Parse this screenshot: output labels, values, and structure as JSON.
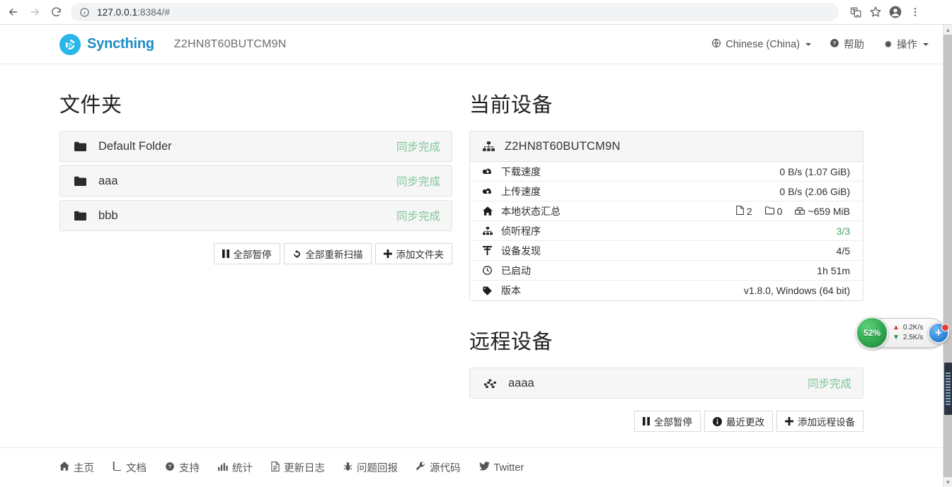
{
  "browser": {
    "url_main": "127.0.0.1",
    "url_rest": ":8384/#",
    "back_icon": "arrow-left-icon",
    "forward_icon": "arrow-right-icon",
    "reload_icon": "reload-icon",
    "info_icon": "info-circle-icon",
    "translate_icon": "translate-icon",
    "bookmark_icon": "star-icon",
    "profile_icon": "profile-avatar-icon",
    "menu_icon": "three-dot-menu-icon"
  },
  "navbar": {
    "brand": "Syncthing",
    "device_id": "Z2HN8T60BUTCM9N",
    "language": "Chinese (China)",
    "help": "帮助",
    "actions": "操作"
  },
  "folders": {
    "title": "文件夹",
    "items": [
      {
        "name": "Default Folder",
        "status": "同步完成"
      },
      {
        "name": "aaa",
        "status": "同步完成"
      },
      {
        "name": "bbb",
        "status": "同步完成"
      }
    ],
    "buttons": [
      {
        "label": "全部暂停",
        "icon": "pause-icon"
      },
      {
        "label": "全部重新扫描",
        "icon": "refresh-icon"
      },
      {
        "label": "添加文件夹",
        "icon": "plus-icon"
      }
    ]
  },
  "current_device": {
    "title": "当前设备",
    "name": "Z2HN8T60BUTCM9N",
    "stats": [
      {
        "icon": "cloud-download-icon",
        "label": "下载速度",
        "value": "0 B/s (1.07 GiB)",
        "green": false
      },
      {
        "icon": "cloud-upload-icon",
        "label": "上传速度",
        "value": "0 B/s (2.06 GiB)",
        "green": false
      },
      {
        "icon": "home-icon",
        "label": "本地状态汇总",
        "value": "",
        "green": false,
        "parts": [
          {
            "icon": "file-icon",
            "text": "2"
          },
          {
            "icon": "folder-outline-icon",
            "text": "0"
          },
          {
            "icon": "hard-drive-icon",
            "text": "~659 MiB"
          }
        ]
      },
      {
        "icon": "sitemap-icon",
        "label": "侦听程序",
        "value": "3/3",
        "green": true
      },
      {
        "icon": "rss-icon",
        "label": "设备发现",
        "value": "4/5",
        "green": false
      },
      {
        "icon": "clock-icon",
        "label": "已启动",
        "value": "1h 51m",
        "green": false
      },
      {
        "icon": "tag-icon",
        "label": "版本",
        "value": "v1.8.0, Windows (64 bit)",
        "green": false
      }
    ]
  },
  "remote_devices": {
    "title": "远程设备",
    "items": [
      {
        "name": "aaaa",
        "status": "同步完成"
      }
    ],
    "buttons": [
      {
        "label": "全部暂停",
        "icon": "pause-icon"
      },
      {
        "label": "最近更改",
        "icon": "info-icon"
      },
      {
        "label": "添加远程设备",
        "icon": "plus-icon"
      }
    ]
  },
  "footer": {
    "links": [
      {
        "label": "主页",
        "icon": "home-icon"
      },
      {
        "label": "文档",
        "icon": "book-icon"
      },
      {
        "label": "支持",
        "icon": "question-circle-icon"
      },
      {
        "label": "统计",
        "icon": "bar-chart-icon"
      },
      {
        "label": "更新日志",
        "icon": "file-text-icon"
      },
      {
        "label": "问题回报",
        "icon": "bug-icon"
      },
      {
        "label": "源代码",
        "icon": "wrench-icon"
      },
      {
        "label": "Twitter",
        "icon": "twitter-icon"
      }
    ]
  },
  "speed_widget": {
    "percent": "52%",
    "upload": "0.2K/s",
    "download": "2.5K/s",
    "plus": "+"
  },
  "colors": {
    "brand": "#1a8bc4",
    "logo": "#29b6e8",
    "status_green": "#7ec699",
    "value_green": "#4ba163"
  }
}
